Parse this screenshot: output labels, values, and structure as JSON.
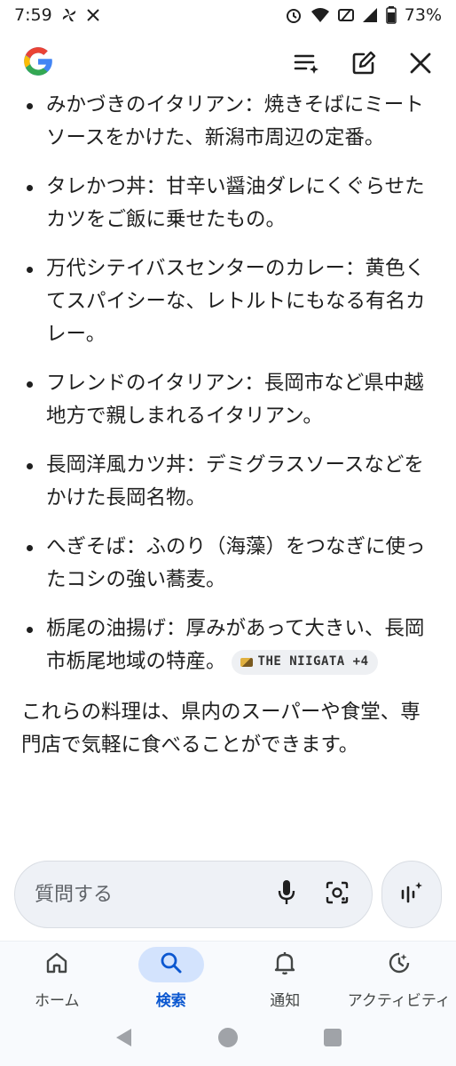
{
  "status_bar": {
    "time": "7:59",
    "battery_text": "73%",
    "icons": [
      "fan-notification-icon",
      "x-notification-icon",
      "alarm-icon",
      "wifi-icon",
      "mute-icon",
      "signal-icon",
      "battery-icon"
    ]
  },
  "header": {
    "logo": "google-g-logo",
    "actions": [
      "list-sparkle-icon",
      "edit-icon",
      "close-icon"
    ]
  },
  "bullets": [
    "みかづきのイタリアン：焼きそばにミートソースをかけた、新潟市周辺の定番。",
    "タレかつ丼：甘辛い醤油ダレにくぐらせたカツをご飯に乗せたもの。",
    "万代シテイバスセンターのカレー：黄色くてスパイシーな、レトルトにもなる有名カレー。",
    "フレンドのイタリアン：長岡市など県中越地方で親しまれるイタリアン。",
    "長岡洋風カツ丼：デミグラスソースなどをかけた長岡名物。",
    "へぎそば：ふのり（海藻）をつなぎに使ったコシの強い蕎麦。",
    "栃尾の油揚げ：厚みがあって大きい、長岡市栃尾地域の特産。"
  ],
  "citation": {
    "label": "THE NIIGATA +4"
  },
  "summary": "これらの料理は、県内のスーパーや食堂、専門店で気軽に食べることができます。",
  "ask": {
    "placeholder": "質問する"
  },
  "bottom_nav": [
    {
      "label": "ホーム",
      "icon": "home-icon",
      "active": false
    },
    {
      "label": "検索",
      "icon": "search-icon",
      "active": true
    },
    {
      "label": "通知",
      "icon": "bell-icon",
      "active": false
    },
    {
      "label": "アクティビティ",
      "icon": "activity-icon",
      "active": false
    }
  ],
  "colors": {
    "accent": "#0b57d0",
    "active_pill": "#d3e3fd",
    "input_bg": "#eef1f6",
    "text": "#1f1f1f"
  }
}
